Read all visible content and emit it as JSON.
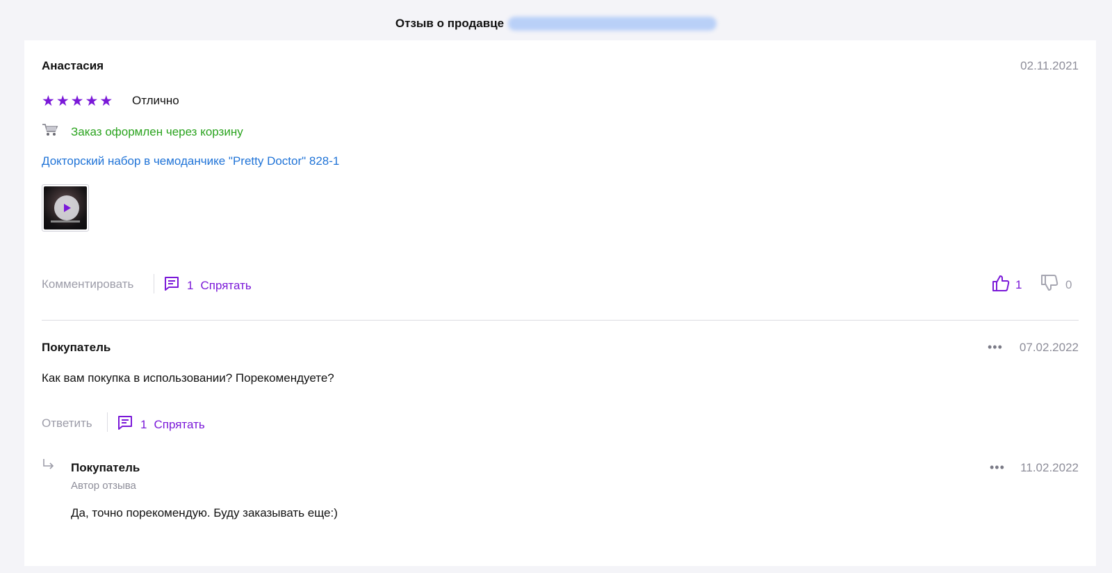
{
  "header": {
    "title": "Отзыв о продавце"
  },
  "review": {
    "author": "Анастасия",
    "date": "02.11.2021",
    "rating": 5,
    "rating_label": "Отлично",
    "order_note": "Заказ оформлен через корзину",
    "product_link": "Докторский набор в чемоданчике \"Pretty Doctor\" 828-1",
    "comment_label": "Комментировать",
    "comments_count": "1",
    "hide_label": "Спрятать",
    "likes": "1",
    "dislikes": "0",
    "icons": {
      "cart": "cart-icon",
      "play": "play-icon",
      "comment": "comment-icon",
      "like": "thumb-up-icon",
      "dislike": "thumb-down-icon"
    }
  },
  "comment": {
    "author": "Покупатель",
    "date": "07.02.2022",
    "text": "Как вам покупка в использовании? Порекомендуете?",
    "reply_label": "Ответить",
    "replies_count": "1",
    "hide_label": "Спрятать"
  },
  "reply": {
    "author": "Покупатель",
    "role": "Автор отзыва",
    "date": "11.02.2022",
    "text": "Да, точно порекомендую. Буду заказывать еще:)"
  },
  "colors": {
    "accent": "#7a18d8",
    "link": "#1f73d7",
    "success": "#2aa31e",
    "muted": "#9c9ca8"
  }
}
